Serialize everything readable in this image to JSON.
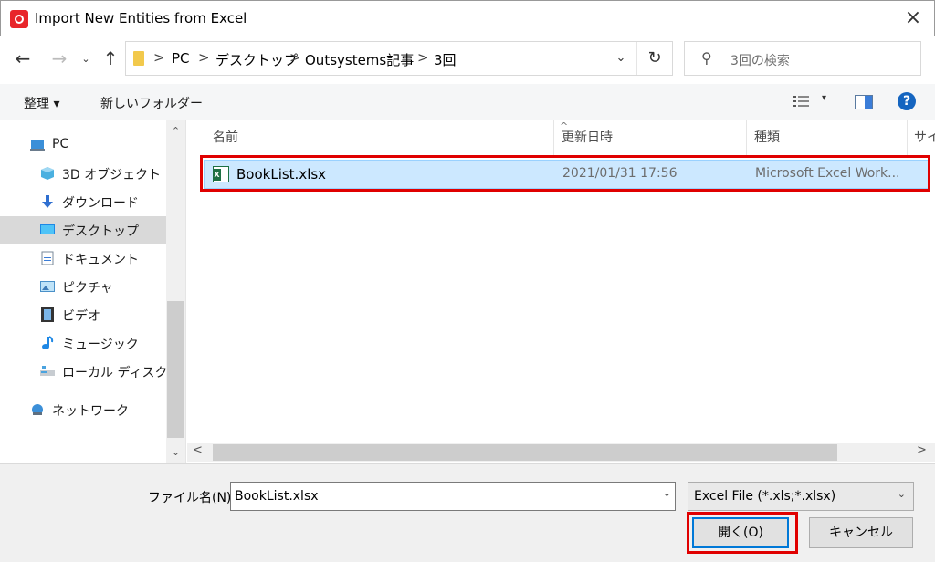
{
  "window": {
    "title": "Import New Entities from Excel",
    "close_icon": "×"
  },
  "nav": {
    "back": "←",
    "forward": "→",
    "recent": "⌄",
    "up": "↑"
  },
  "address": {
    "breadcrumbs": [
      "PC",
      "デスクトップ",
      "Outsystems記事",
      "3回"
    ],
    "separator": ">",
    "dropdown": "⌄",
    "refresh": "↻"
  },
  "search": {
    "placeholder": "3回の検索",
    "icon": "⚲"
  },
  "toolbar": {
    "organize": "整理 ▾",
    "new_folder": "新しいフォルダー",
    "view_dropdown": "▾",
    "help": "?"
  },
  "sidebar": {
    "items": [
      {
        "label": "PC",
        "icon": "pc-icon"
      },
      {
        "label": "3D オブジェクト",
        "icon": "3d-objects-icon"
      },
      {
        "label": "ダウンロード",
        "icon": "download-icon"
      },
      {
        "label": "デスクトップ",
        "icon": "desktop-icon",
        "selected": true
      },
      {
        "label": "ドキュメント",
        "icon": "documents-icon"
      },
      {
        "label": "ピクチャ",
        "icon": "pictures-icon"
      },
      {
        "label": "ビデオ",
        "icon": "video-icon"
      },
      {
        "label": "ミュージック",
        "icon": "music-icon"
      },
      {
        "label": "ローカル ディスク (C",
        "icon": "local-disk-icon"
      },
      {
        "label": "ネットワーク",
        "icon": "network-icon"
      }
    ],
    "scroll_up": "⌃",
    "scroll_down": "⌄"
  },
  "file_list": {
    "columns": [
      "名前",
      "更新日時",
      "種類",
      "サイ"
    ],
    "sort_caret": "^",
    "rows": [
      {
        "name": "BookList.xlsx",
        "modified": "2021/01/31 17:56",
        "type": "Microsoft Excel Work..."
      }
    ],
    "scroll_left": "<",
    "scroll_right": ">"
  },
  "footer": {
    "filename_label": "ファイル名(N):",
    "filename_value": "BookList.xlsx",
    "filename_dropdown": "⌄",
    "filter_value": "Excel File (*.xls;*.xlsx)",
    "filter_dropdown": "⌄",
    "open_button": "開く(O)",
    "cancel_button": "キャンセル"
  },
  "colors": {
    "selection": "#cce8ff",
    "highlight_border": "#e00000",
    "accent": "#0078d7"
  }
}
